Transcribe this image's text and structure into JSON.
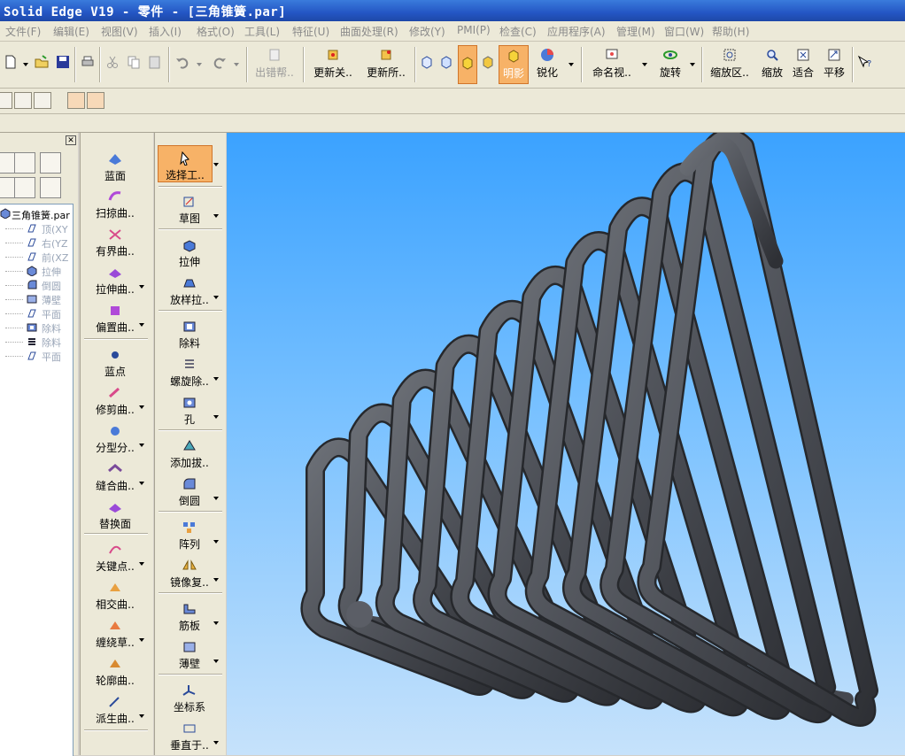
{
  "titlebar": {
    "title": "Solid Edge V19 - 零件 - [三角锥簧.par]"
  },
  "menu": [
    "文件(F)",
    "编辑(E)",
    "视图(V)",
    "插入(I)",
    "格式(O)",
    "工具(L)",
    "特征(U)",
    "曲面处理(R)",
    "修改(Y)",
    "PMI(P)",
    "检查(C)",
    "应用程序(A)",
    "管理(M)",
    "窗口(W)",
    "帮助(H)"
  ],
  "toolbar": {
    "error_help": "出错帮..",
    "update_rel": "更新关..",
    "update_all": "更新所..",
    "shaded": "明影",
    "sharpen": "锐化",
    "named_view": "命名视..",
    "rotate": "旋转",
    "zoom_area": "缩放区..",
    "zoom": "缩放",
    "fit": "适合",
    "pan": "平移"
  },
  "tree": {
    "root": "三角锥簧.par",
    "items": [
      "顶(XY",
      "右(YZ",
      "前(XZ",
      "拉伸",
      "倒圆",
      "薄壁",
      "平面",
      "除料",
      "除料",
      "平面"
    ]
  },
  "surface_tools": [
    "蓝面",
    "扫掠曲..",
    "有界曲..",
    "拉伸曲..",
    "偏置曲..",
    "蓝点",
    "修剪曲..",
    "分型分..",
    "缝合曲..",
    "替换面",
    "关键点..",
    "相交曲..",
    "缠绕草..",
    "轮廓曲..",
    "派生曲.."
  ],
  "feature_tools": [
    "选择工..",
    "草图",
    "拉伸",
    "放样拉..",
    "除料",
    "螺旋除..",
    "孔",
    "添加拔..",
    "倒圆",
    "阵列",
    "镜像复..",
    "筋板",
    "薄壁",
    "坐标系",
    "垂直于.."
  ],
  "colors": {
    "accent": "#f7b267",
    "viewport_top": "#3ba2ff",
    "viewport_bottom": "#c6e2fb",
    "model": "#55585e"
  }
}
